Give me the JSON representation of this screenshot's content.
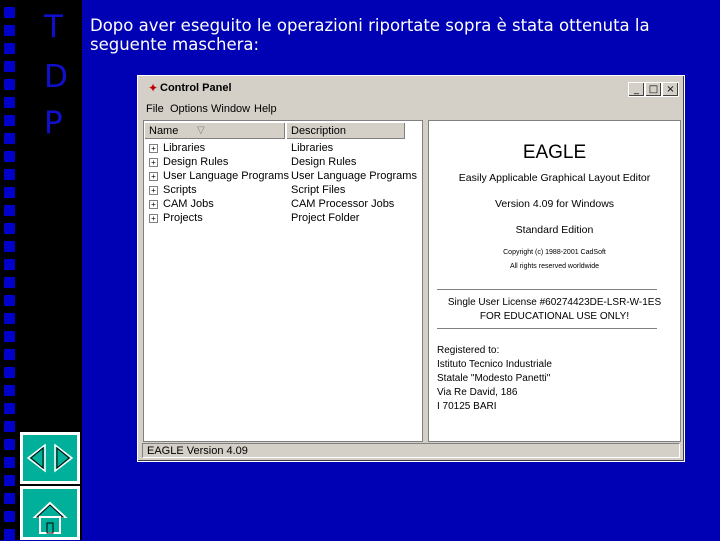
{
  "slide": {
    "letters": [
      "T",
      "D",
      "P"
    ],
    "caption": "Dopo aver eseguito le operazioni riportate sopra è stata ottenuta la seguente maschera:",
    "nav": {
      "prev_icon": "triangle-left-icon",
      "next_icon": "triangle-right-icon",
      "home_icon": "home-icon"
    },
    "colors": {
      "background": "#0000b4",
      "strip": "#000000",
      "nav": "#00b09a"
    }
  },
  "window": {
    "title": "Control Panel",
    "buttons": {
      "minimize": "_",
      "maximize": "□",
      "close": "×"
    },
    "menu": [
      "File",
      "Options",
      "Window",
      "Help"
    ],
    "tree": {
      "headers": {
        "name": "Name",
        "description": "Description"
      },
      "rows": [
        {
          "name": "Libraries",
          "description": "Libraries"
        },
        {
          "name": "Design Rules",
          "description": "Design Rules"
        },
        {
          "name": "User Language Programs",
          "description": "User Language Programs"
        },
        {
          "name": "Scripts",
          "description": "Script Files"
        },
        {
          "name": "CAM Jobs",
          "description": "CAM Processor Jobs"
        },
        {
          "name": "Projects",
          "description": "Project Folder"
        }
      ]
    },
    "about": {
      "product": "EAGLE",
      "expansion": "Easily Applicable Graphical Layout Editor",
      "version": "Version 4.09 for Windows",
      "edition": "Standard Edition",
      "copyright": "Copyright (c) 1988-2001 CadSoft",
      "rights": "All rights reserved worldwide",
      "license_line1": "Single User License #60274423DE-LSR-W-1ES",
      "license_line2": "FOR EDUCATIONAL USE ONLY!",
      "registered": [
        "Registered to:",
        "Istituto Tecnico Industriale",
        "Statale \"Modesto Panetti\"",
        "Via Re David, 186",
        "I 70125 BARI"
      ]
    },
    "status": "EAGLE Version 4.09"
  }
}
